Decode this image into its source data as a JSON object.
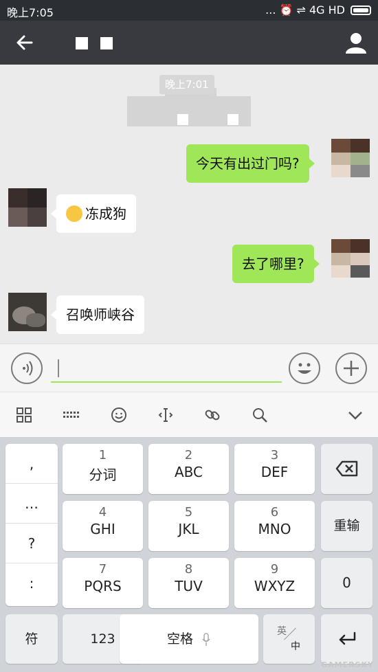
{
  "status_bar": {
    "time": "晚上7:05",
    "indicators": "... ⏰ ⇌ 4G HD"
  },
  "nav": {
    "back_icon": "arrow-left-icon",
    "profile_icon": "person-icon"
  },
  "chat": {
    "timestamp": "晚上7:01",
    "messages": [
      {
        "side": "out",
        "text": "今天有出过门吗?"
      },
      {
        "side": "in",
        "emoji": "flushed-face",
        "text": "冻成狗"
      },
      {
        "side": "out",
        "text": "去了哪里?"
      },
      {
        "side": "in",
        "text": "召唤师峡谷"
      }
    ]
  },
  "keyboard": {
    "symbols": [
      ",",
      "…",
      "?",
      ":"
    ],
    "keys": [
      {
        "num": "1",
        "label": "分词"
      },
      {
        "num": "2",
        "label": "ABC"
      },
      {
        "num": "3",
        "label": "DEF"
      },
      {
        "num": "4",
        "label": "GHI"
      },
      {
        "num": "5",
        "label": "JKL"
      },
      {
        "num": "6",
        "label": "MNO"
      },
      {
        "num": "7",
        "label": "PQRS"
      },
      {
        "num": "8",
        "label": "TUV"
      },
      {
        "num": "9",
        "label": "WXYZ"
      }
    ],
    "retype": "重输",
    "zero": "0",
    "fu": "符",
    "num123": "123",
    "space": "空格",
    "lang_top": "英",
    "lang_bottom": "中"
  },
  "watermark": "GAMERSKY",
  "colors": {
    "nav": "#393a3f",
    "bubble_out": "#9fe659",
    "bubble_in": "#ffffff",
    "status": "#2b2e33"
  }
}
